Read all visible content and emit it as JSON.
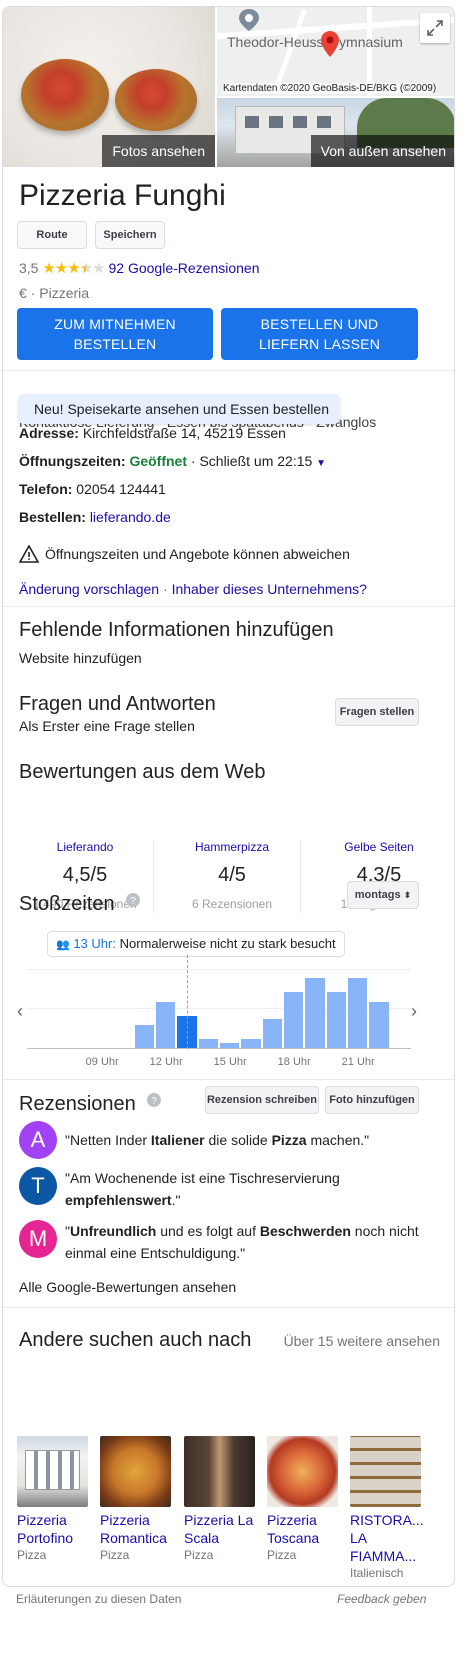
{
  "hero": {
    "photos_button": "Fotos ansehen",
    "outside_button": "Von außen ansehen",
    "map_label": "Theodor-Heuss-Gymnasium",
    "map_credit": "Kartendaten ©2020 GeoBasis-DE/BKG (©2009)"
  },
  "business": {
    "name": "Pizzeria Funghi",
    "route_button": "Route",
    "save_button": "Speichern",
    "rating": "3,5",
    "reviews_link": "92 Google-Rezensionen",
    "price": "€",
    "category": "Pizzeria",
    "takeaway_button": "ZUM MITNEHMEN BESTELLEN",
    "delivery_button": "BESTELLEN UND LIEFERN LASSEN",
    "menu_banner": "Neu! Speisekarte ansehen und Essen bestellen",
    "features": "Kontaktlose Lieferung · Essen bis spätabends · Zwanglos"
  },
  "details": {
    "address_label": "Adresse:",
    "address": "Kirchfeldstraße 14, 45219 Essen",
    "hours_label": "Öffnungszeiten:",
    "hours_status": "Geöffnet",
    "hours_close": "· Schließt um 22:15",
    "phone_label": "Telefon:",
    "phone": "02054 124441",
    "order_label": "Bestellen:",
    "order_link": "lieferando.de",
    "warning": "Öffnungszeiten und Angebote können abweichen",
    "suggest_link": "Änderung vorschlagen",
    "owner_link": "Inhaber dieses Unternehmens?"
  },
  "missing": {
    "heading": "Fehlende Informationen hinzufügen",
    "add_website": "Website hinzufügen"
  },
  "qa": {
    "heading": "Fragen und Antworten",
    "first_question": "Als Erster eine Frage stellen",
    "ask_button": "Fragen stellen"
  },
  "web_reviews": {
    "heading": "Bewertungen aus dem Web",
    "items": [
      {
        "source": "Lieferando",
        "score": "4,5/5",
        "count": "1.490 Rezensionen"
      },
      {
        "source": "Hammerpizza",
        "score": "4/5",
        "count": "6 Rezensionen"
      },
      {
        "source": "Gelbe Seiten",
        "score": "4,3/5",
        "count": "15 Ergebnisse"
      }
    ]
  },
  "popular_times": {
    "heading": "Stoßzeiten",
    "day_select": "montags",
    "tooltip_time": "13 Uhr:",
    "tooltip_text": "Normalerweise nicht zu stark besucht",
    "ticks": [
      "09 Uhr",
      "12 Uhr",
      "15 Uhr",
      "18 Uhr",
      "21 Uhr"
    ]
  },
  "chart_data": {
    "type": "bar",
    "categories": [
      "06",
      "07",
      "08",
      "09",
      "10",
      "11",
      "12",
      "13",
      "14",
      "15",
      "16",
      "17",
      "18",
      "19",
      "20",
      "21",
      "22",
      "23"
    ],
    "values": [
      0,
      0,
      0,
      0,
      0,
      30,
      60,
      42,
      12,
      6,
      12,
      38,
      74,
      92,
      74,
      92,
      60,
      0
    ],
    "current_index": 7,
    "ylim": [
      0,
      100
    ],
    "xlabel": "",
    "ylabel": ""
  },
  "reviews": {
    "heading": "Rezensionen",
    "write_button": "Rezension schreiben",
    "photo_button": "Foto hinzufügen",
    "items": [
      {
        "initial": "A",
        "color": "#a142f4"
      },
      {
        "initial": "T",
        "color": "#0b57a4"
      },
      {
        "initial": "M",
        "color": "#e52592"
      }
    ],
    "r1_a": "\"Netten Inder ",
    "r1_b": "Italiener",
    "r1_c": " die solide ",
    "r1_d": "Pizza",
    "r1_e": " machen.\"",
    "r2_a": "\"Am Wochenende ist eine Tischreservierung ",
    "r2_b": "empfehlenswert",
    "r2_c": ".\"",
    "r3_a": "\"",
    "r3_b": "Unfreundlich",
    "r3_c": " und es folgt auf ",
    "r3_d": "Beschwerden",
    "r3_e": " noch nicht einmal eine Entschuldigung.\"",
    "all_link": "Alle Google-Bewertungen ansehen"
  },
  "also_search": {
    "heading": "Andere suchen auch nach",
    "more": "Über 15 weitere ansehen",
    "items": [
      {
        "name": "Pizzeria Portofino",
        "type": "Pizza"
      },
      {
        "name": "Pizzeria Romantica",
        "type": "Pizza"
      },
      {
        "name": "Pizzeria La Scala",
        "type": "Pizza"
      },
      {
        "name": "Pizzeria Toscana",
        "type": "Pizza"
      },
      {
        "name": "RISTORA... LA FIAMMA...",
        "type": "Italienisch"
      }
    ]
  },
  "footer": {
    "explain": "Erläuterungen zu diesen Daten",
    "feedback": "Feedback geben"
  },
  "colors": {
    "accent": "#1a73e8",
    "link": "#1a0dab",
    "open": "#188038",
    "bar": "#8ab4f8",
    "star": "#fbbc04"
  }
}
